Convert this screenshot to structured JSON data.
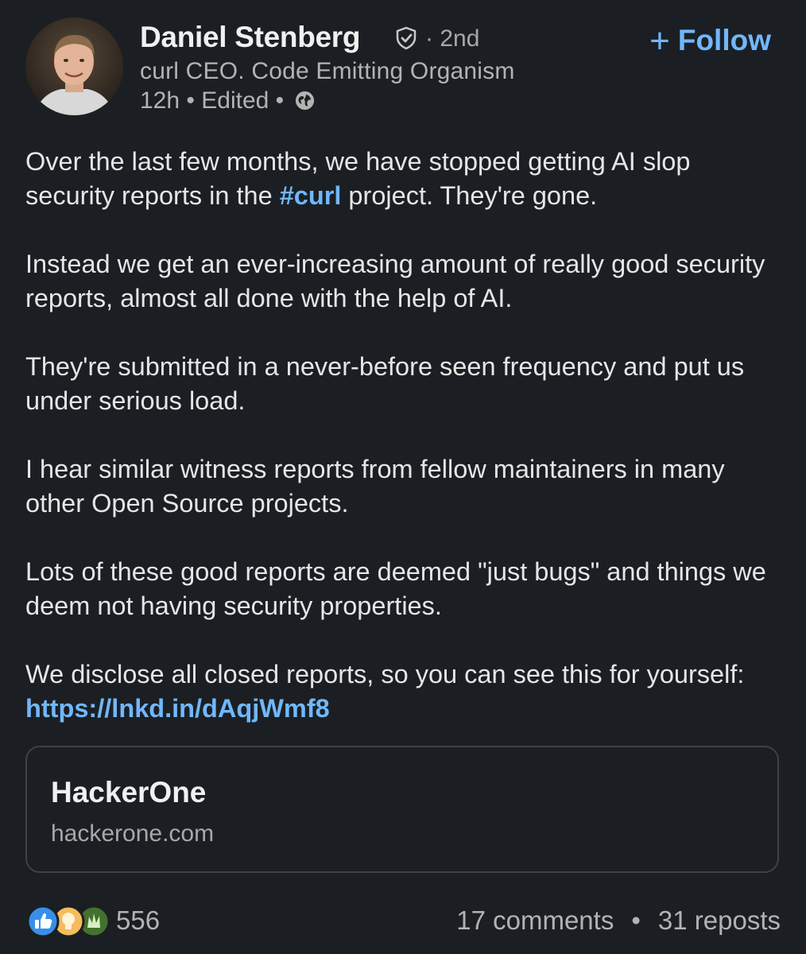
{
  "author": {
    "name": "Daniel Stenberg",
    "degree": "· 2nd",
    "headline": "curl CEO. Code Emitting Organism",
    "time": "12h",
    "edited": "Edited",
    "visibility_icon": "globe-icon",
    "verified_icon": "verified-shield-icon"
  },
  "follow": {
    "icon": "+",
    "label": "Follow"
  },
  "post": {
    "p1_before": "Over the last few months, we have stopped getting AI slop security reports in the ",
    "p1_hashtag": "#curl",
    "p1_after": " project. They're gone.",
    "p2": "Instead we get an ever-increasing amount of really good security reports, almost all done with the help of AI.",
    "p3": "They're submitted in a never-before seen frequency and put us under serious load.",
    "p4": "I hear similar witness reports from fellow maintainers in many other Open Source projects.",
    "p5": "Lots of these good reports are deemed \"just bugs\" and things we deem not having security properties.",
    "p6_before": "We disclose all closed reports, so you can see this for yourself: ",
    "p6_link": "https://lnkd.in/dAqjWmf8"
  },
  "link_card": {
    "title": "HackerOne",
    "domain": "hackerone.com"
  },
  "engagement": {
    "reactions_count": "556",
    "reaction_icons": [
      "like-icon",
      "insightful-icon",
      "celebrate-icon"
    ],
    "comments": "17 comments",
    "separator": "•",
    "reposts": "31 reposts"
  },
  "colors": {
    "background": "#1b1f23",
    "accent_link": "#71b7fb",
    "like_blue": "#378fe9",
    "insightful_yellow": "#f5bb5c",
    "celebrate_green": "#44712e"
  }
}
